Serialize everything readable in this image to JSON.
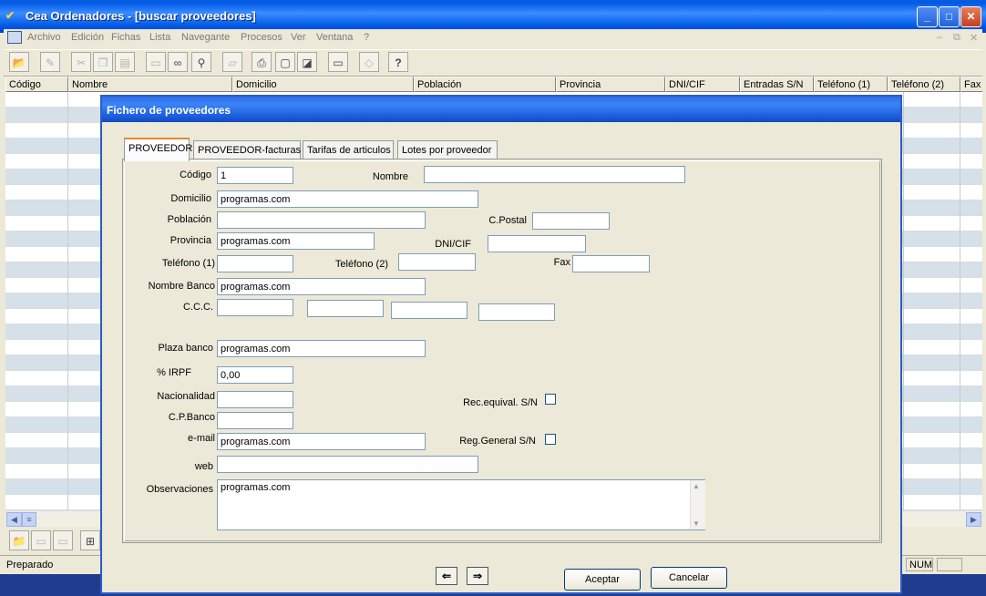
{
  "window": {
    "title": "Cea Ordenadores  - [buscar proveedores]"
  },
  "menu": [
    "Archivo",
    "Edición",
    "Fichas",
    "Lista",
    "Navegante",
    "Procesos",
    "Ver",
    "Ventana",
    "?"
  ],
  "toolbar": {
    "icons": [
      "open-folder-icon",
      "edit-icon",
      "cut-icon",
      "copy-icon",
      "paste-icon",
      "window-icon",
      "binoculars-icon",
      "magnifier-icon",
      "scanner-icon",
      "printer-icon",
      "print-preview-icon",
      "export-icon",
      "monitor-icon",
      "tag-icon",
      "help-icon"
    ]
  },
  "grid": {
    "columns": [
      "Código",
      "Nombre",
      "Domicilio",
      "Población",
      "Provincia",
      "DNI/CIF",
      "Entradas S/N",
      "Teléfono (1)",
      "Teléfono (2)",
      "Fax"
    ]
  },
  "status": {
    "text": "Preparado",
    "num": "NUM"
  },
  "dialog": {
    "title": "Fichero de proveedores",
    "tabs": [
      "PROVEEDOR",
      "PROVEEDOR-facturas",
      "Tarifas de articulos",
      "Lotes por proveedor"
    ],
    "labels": {
      "codigo": "Código",
      "nombre": "Nombre",
      "domicilio": "Domicilio",
      "poblacion": "Población",
      "cpostal": "C.Postal",
      "provincia": "Provincia",
      "dnicif": "DNI/CIF",
      "telefono1": "Teléfono (1)",
      "telefono2": "Teléfono (2)",
      "fax": "Fax",
      "nombre_banco": "Nombre Banco",
      "ccc": "C.C.C.",
      "plaza_banco": "Plaza banco",
      "irpf": "% IRPF",
      "nacionalidad": "Nacionalidad",
      "cp_banco": "C.P.Banco",
      "email": "e-mail",
      "web": "web",
      "observaciones": "Observaciones",
      "rec_equival": "Rec.equival. S/N",
      "reg_general": "Reg.General S/N"
    },
    "values": {
      "codigo": "1",
      "nombre": "",
      "domicilio": "programas.com",
      "poblacion": "",
      "cpostal": "",
      "provincia": "programas.com",
      "dnicif": "",
      "telefono1": "",
      "telefono2": "",
      "fax": "",
      "nombre_banco": "programas.com",
      "ccc1": "",
      "ccc2": "",
      "ccc3": "",
      "ccc4": "",
      "plaza_banco": "programas.com",
      "irpf": "0,00",
      "nacionalidad": "",
      "cp_banco": "",
      "email": "programas.com",
      "web": "",
      "observaciones": "programas.com"
    },
    "buttons": {
      "accept": "Aceptar",
      "cancel": "Cancelar",
      "prev": "⇐",
      "next": "⇒"
    }
  }
}
